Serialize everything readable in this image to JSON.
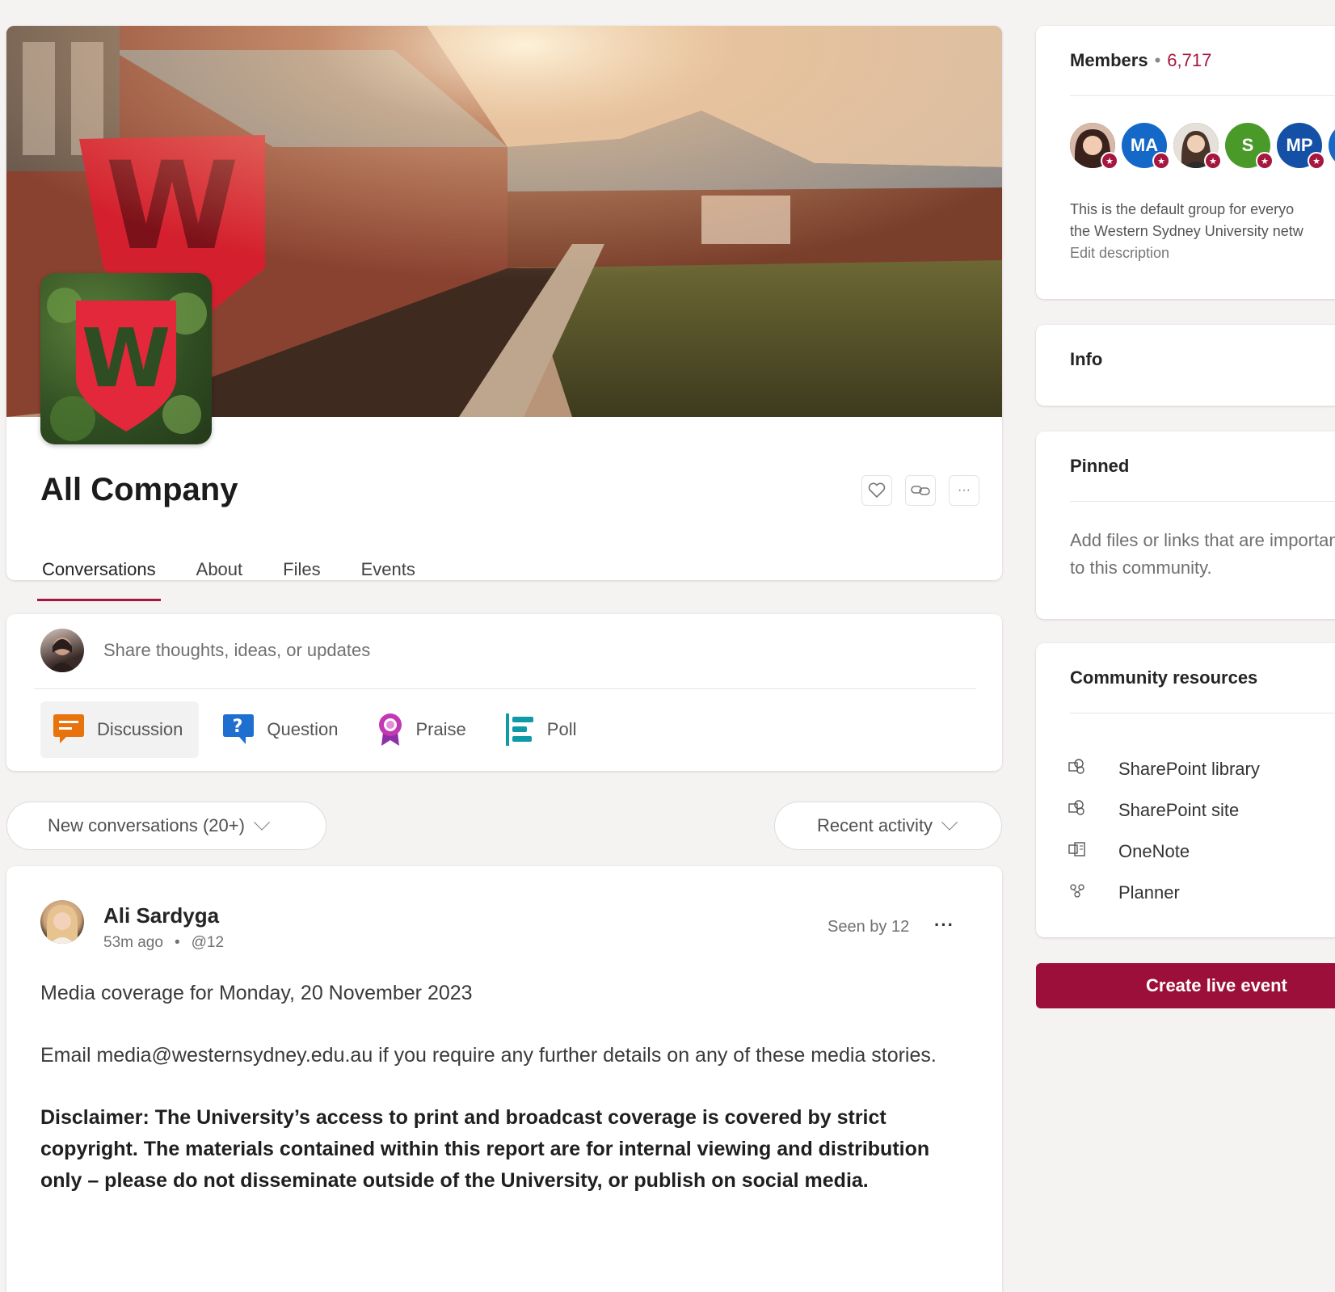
{
  "header": {
    "title": "All Company",
    "logo_letter": "W",
    "tabs": [
      {
        "label": "Conversations",
        "active": true
      },
      {
        "label": "About",
        "active": false
      },
      {
        "label": "Files",
        "active": false
      },
      {
        "label": "Events",
        "active": false
      }
    ],
    "actions": [
      "heart-icon",
      "link-icon",
      "more-icon"
    ],
    "more_glyph": "···"
  },
  "composer": {
    "placeholder": "Share thoughts, ideas, or updates",
    "post_types": [
      {
        "label": "Discussion",
        "icon": "discussion-icon",
        "color": "#e8730c"
      },
      {
        "label": "Question",
        "icon": "question-icon",
        "color": "#1f6fd1"
      },
      {
        "label": "Praise",
        "icon": "praise-icon",
        "color": "#c239b3"
      },
      {
        "label": "Poll",
        "icon": "poll-icon",
        "color": "#0f9aa8"
      }
    ]
  },
  "filters": {
    "feed": "New conversations (20+)",
    "sort": "Recent activity"
  },
  "post": {
    "author": "Ali Sardyga",
    "time": "53m ago",
    "dot": "•",
    "mention": "@12",
    "seen_by": "Seen by 12",
    "more_glyph": "···",
    "paragraph_1": "Media coverage for Monday, 20 November 2023",
    "paragraph_2": "Email media@westernsydney.edu.au if you require any further details on any of these media stories.",
    "paragraph_3": "Disclaimer: The University’s access to print and broadcast coverage is covered by strict copyright. The materials contained within this report are for internal viewing and distribution only – please do not disseminate outside of the University, or publish on social media."
  },
  "sidebar": {
    "members_label": "Members",
    "members_dot": "•",
    "members_count": "6,717",
    "member_avatars": [
      {
        "initials": "",
        "color": "#5b4a44"
      },
      {
        "initials": "MA",
        "color": "#1468c8"
      },
      {
        "initials": "",
        "color": "#8a7565"
      },
      {
        "initials": "S",
        "color": "#4a9a2a"
      },
      {
        "initials": "MP",
        "color": "#1451a6"
      },
      {
        "initials": "",
        "color": "#1468c8"
      }
    ],
    "description_line_1": "This is the default group for everyo",
    "description_line_2": "the Western Sydney University netw",
    "edit_description": "Edit description",
    "info_label": "Info",
    "pinned_label": "Pinned",
    "pinned_text": "Add files or links that are important to this community.",
    "resources_label": "Community resources",
    "resources": [
      {
        "label": "SharePoint library",
        "icon": "sharepoint-icon"
      },
      {
        "label": "SharePoint site",
        "icon": "sharepoint-icon"
      },
      {
        "label": "OneNote",
        "icon": "onenote-icon"
      },
      {
        "label": "Planner",
        "icon": "planner-icon"
      }
    ],
    "live_event_button": "Create live event"
  },
  "colors": {
    "accent": "#a6173f",
    "live_button": "#9b0f3a",
    "background": "#f5f2f2"
  }
}
